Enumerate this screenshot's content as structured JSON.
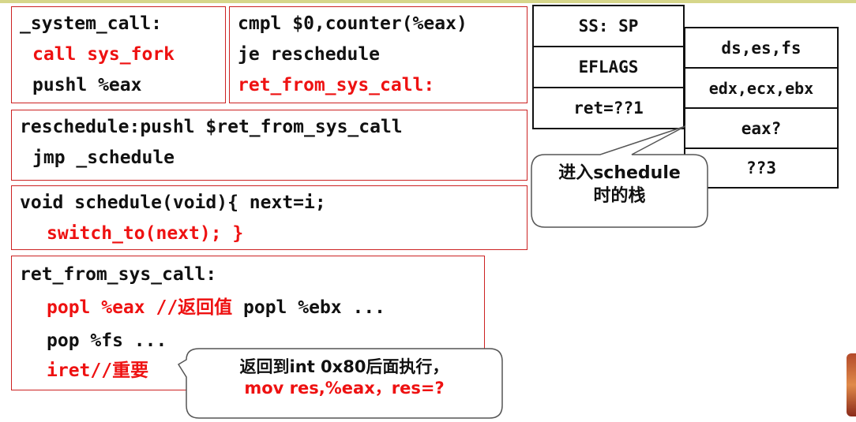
{
  "code_blocks": {
    "system_call": {
      "label": "_system_call:",
      "line1": "call sys_fork",
      "line2": "pushl %eax"
    },
    "counter": {
      "line1": "cmpl $0,counter(%eax)",
      "line2": "je reschedule",
      "line3": "ret_from_sys_call:"
    },
    "reschedule": {
      "line1": "reschedule:pushl $ret_from_sys_call",
      "line2": "jmp _schedule"
    },
    "schedule": {
      "line1": "void schedule(void){ next=i;",
      "line2": "switch_to(next); }"
    },
    "ret_from": {
      "line1": "ret_from_sys_call:",
      "line2_code": "popl %eax //",
      "line2_cjk": "返回值",
      "line2_tail": " popl %ebx ...",
      "line3": "pop %fs ...",
      "line4_code": "iret//",
      "line4_cjk": "重要"
    }
  },
  "stack_left": {
    "cells": [
      "SS: SP",
      "EFLAGS",
      "ret=??1"
    ]
  },
  "stack_right": {
    "cells": [
      "ds,es,fs",
      "edx,ecx,ebx",
      "eax?",
      "??3"
    ]
  },
  "callout_schedule": {
    "line1": "进入schedule",
    "line2": "时的栈"
  },
  "callout_return": {
    "line1": "返回到int 0x80后面执行，",
    "line2": "mov res,%eax，res=?"
  },
  "colors": {
    "red": "#ee1111",
    "box_border": "#cc2222",
    "black": "#111111"
  }
}
